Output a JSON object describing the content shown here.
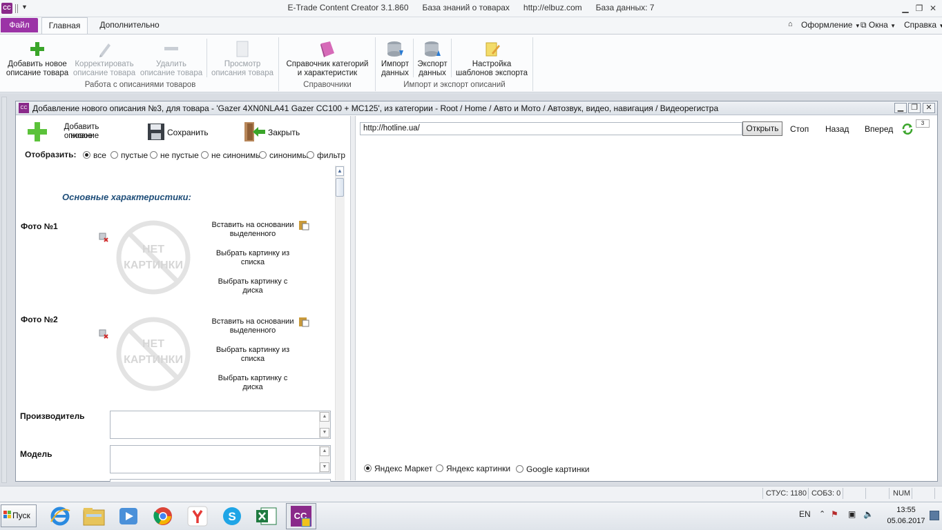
{
  "window": {
    "app_logo": "CC",
    "title": "E-Trade Content Creator 3.1.860      База знаний о товарах      http://elbuz.com      База данных: 7",
    "controls": [
      "minimize-icon",
      "restore-icon",
      "close-icon"
    ]
  },
  "tabs": {
    "file": "Файл",
    "main": "Главная",
    "extra": "Дополнительно"
  },
  "right_menu": {
    "design": "Оформление",
    "windows": "Окна",
    "help": "Справка"
  },
  "ribbon": {
    "add_line1": "Добавить новое",
    "add_line2": "описание товара",
    "edit_line1": "Корректировать",
    "edit_line2": "описание товара",
    "delete_line1": "Удалить",
    "delete_line2": "описание товара",
    "view_line1": "Просмотр",
    "view_line2": "описания товара",
    "group1": "Работа с описаниями товаров",
    "ref_line1": "Справочник категорий",
    "ref_line2": "и характеристик",
    "group2": "Справочники",
    "import_line1": "Импорт",
    "import_line2": "данных",
    "export_line1": "Экспорт",
    "export_line2": "данных",
    "tmpl_line1": "Настройка",
    "tmpl_line2": "шаблонов экспорта",
    "group3": "Импорт и экспорт описаний"
  },
  "child_window": {
    "icon": "CC",
    "title": "Добавление нового описания №3, для товара - 'Gazer 4XN0NLA41 Gazer CC100 + MC125', из категории - Root / Home / Авто и Мото / Автозвук, видео, навигация / Видеорегистра"
  },
  "left_toolbar": {
    "add_line1": "Добавить новое",
    "add_line2": "описание",
    "save": "Сохранить",
    "close": "Закрыть"
  },
  "filter": {
    "label": "Отобразить:",
    "options": [
      "все",
      "пустые",
      "не пустые",
      "не синонимы",
      "синонимы",
      "фильтр"
    ],
    "selected": "все"
  },
  "form": {
    "section_title": "Основные характеристики:",
    "photo1_label": "Фото №1",
    "photo2_label": "Фото №2",
    "no_image_line1": "НЕТ",
    "no_image_line2": "КАРТИНКИ",
    "paste_line1": "Вставить на основании",
    "paste_line2": "выделенного",
    "pick_list_line1": "Выбрать картинку из",
    "pick_list_line2": "списка",
    "pick_disk_line1": "Выбрать картинку с",
    "pick_disk_line2": "диска",
    "manufacturer_label": "Производитель",
    "manufacturer_value": "",
    "model_label": "Модель",
    "model_value": ""
  },
  "browser": {
    "url": "http://hotline.ua/",
    "open": "Открыть",
    "stop": "Стоп",
    "back": "Назад",
    "forward": "Вперед",
    "mini": "3",
    "sources": [
      "Яндекс Маркет",
      "Яндекс картинки",
      "Google картинки"
    ],
    "selected_source": "Яндекс Маркет"
  },
  "statusbar": {
    "stus": "СТУС: 1180",
    "sobz": "СОБЗ: 0",
    "num": "NUM"
  },
  "taskbar": {
    "start": "Пуск",
    "apps": [
      "ie-icon",
      "explorer-icon",
      "media-player-icon",
      "chrome-icon",
      "yandex-browser-icon",
      "skype-icon",
      "excel-icon",
      "content-creator-icon"
    ],
    "lang": "EN",
    "time": "13:55",
    "date": "05.06.2017"
  },
  "colors": {
    "file_tab": "#9b33a6",
    "app_logo": "#8a2a8a",
    "section_title": "#1f4e79",
    "add_icon": "#3aa52a"
  }
}
